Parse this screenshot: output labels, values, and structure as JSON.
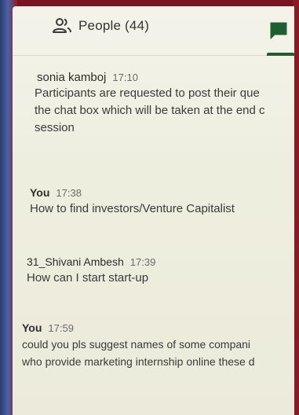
{
  "header": {
    "people_label": "People (44)",
    "people_icon": "people-icon",
    "chat_icon": "chat-bubble-icon",
    "accent_color": "#1f5d33"
  },
  "messages": [
    {
      "sender": "sonia kamboj",
      "time": "17:10",
      "lines": [
        "Participants are requested to post their que",
        "the chat box which will be taken at the end c",
        "session"
      ]
    },
    {
      "sender": "You",
      "time": "17:38",
      "lines": [
        "How to find investors/Venture Capitalist"
      ]
    },
    {
      "sender": "31_Shivani Ambesh",
      "time": "17:39",
      "lines": [
        "How can I  start start-up"
      ]
    },
    {
      "sender": "You",
      "time": "17:59",
      "lines": [
        "could you pls suggest names of some compani",
        "who provide marketing internship online these d"
      ]
    }
  ]
}
